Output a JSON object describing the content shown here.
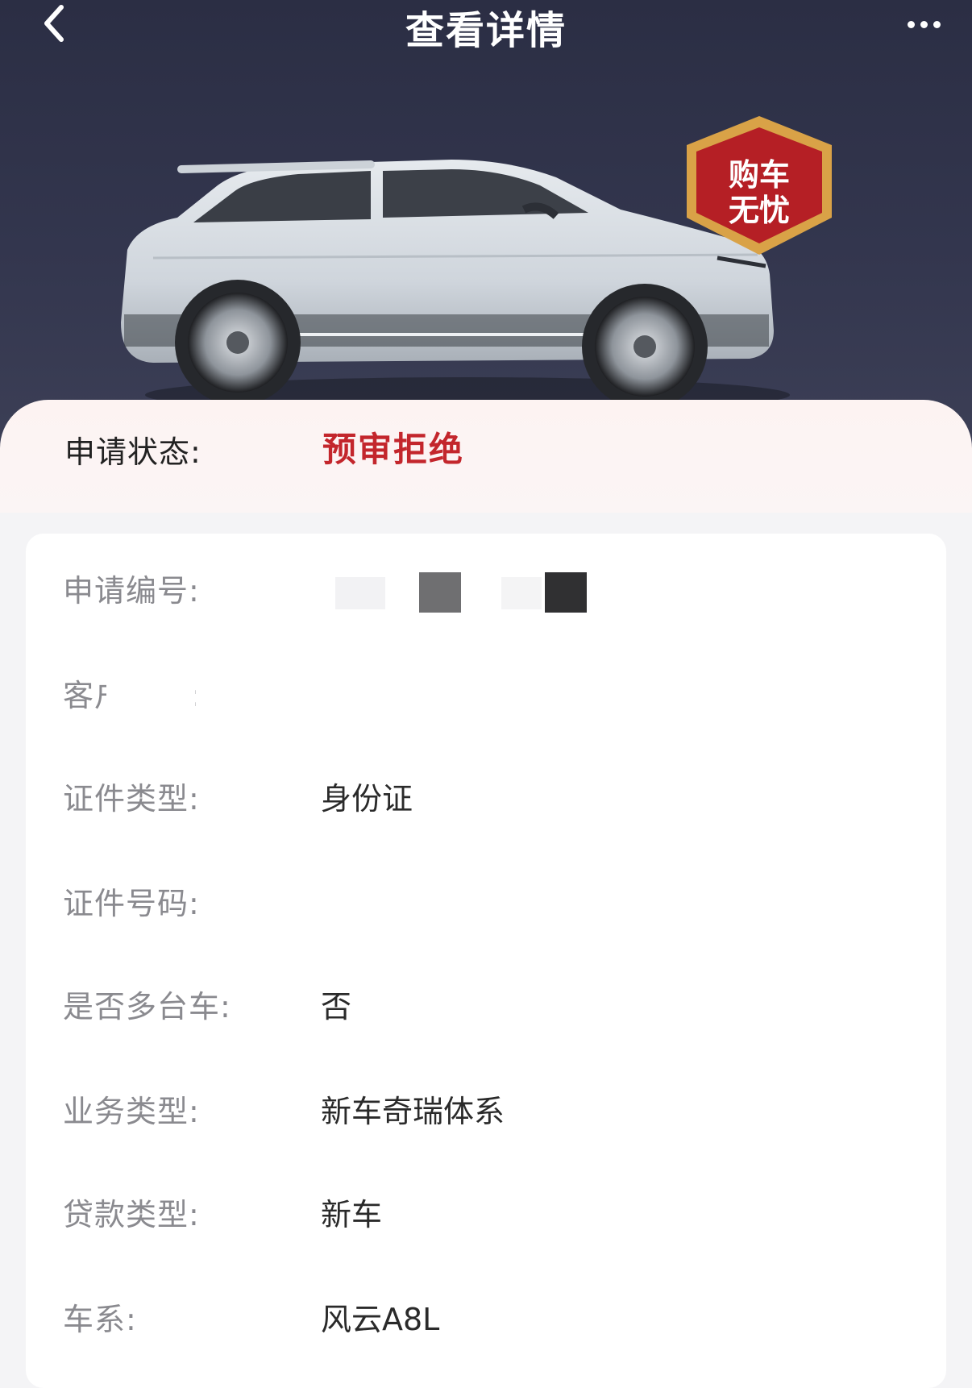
{
  "header": {
    "title": "查看详情"
  },
  "badge": {
    "line1": "购车",
    "line2": "无忧"
  },
  "status": {
    "label": "申请状态:",
    "value": "预审拒绝",
    "value_color": "#c3262c"
  },
  "details": [
    {
      "label": "申请编号:",
      "value": ""
    },
    {
      "label": "客户姓名:",
      "value": ""
    },
    {
      "label": "证件类型:",
      "value": "身份证"
    },
    {
      "label": "证件号码:",
      "value": ""
    },
    {
      "label": "是否多台车:",
      "value": "否"
    },
    {
      "label": "业务类型:",
      "value": "新车奇瑞体系"
    },
    {
      "label": "贷款类型:",
      "value": "新车"
    },
    {
      "label": "车系:",
      "value": "风云A8L"
    }
  ],
  "colors": {
    "hero_bg": "#2e3148",
    "status_bg": "#fdf3f2",
    "accent_red": "#c3262c",
    "badge_gold": "#d9a247"
  },
  "icons": {
    "back": "chevron-left-icon",
    "more": "more-horizontal-icon"
  }
}
